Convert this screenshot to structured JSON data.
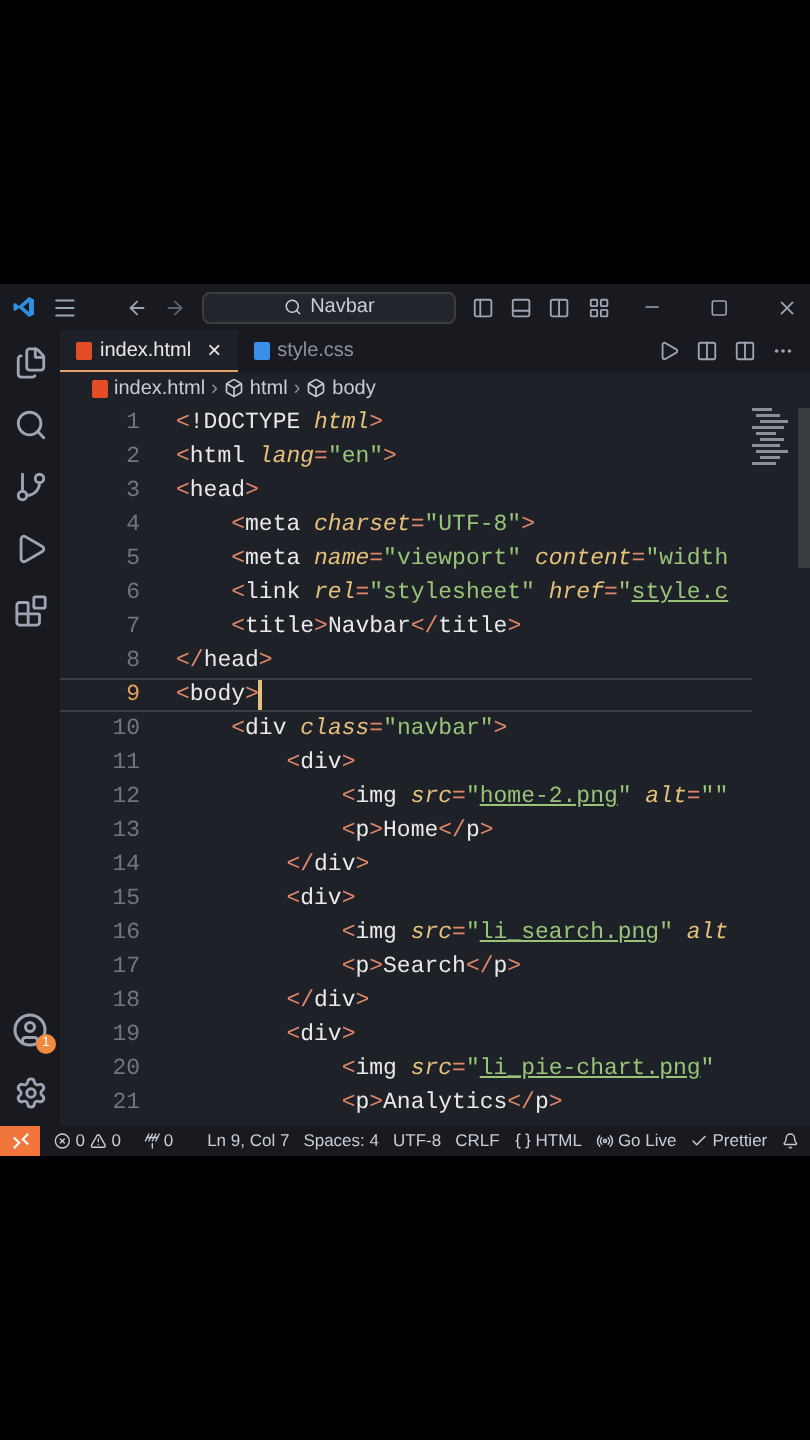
{
  "title_bar": {
    "search": "Navbar"
  },
  "tabs": [
    {
      "label": "index.html",
      "kind": "html",
      "selected": true,
      "close": "×"
    },
    {
      "label": "style.css",
      "kind": "css",
      "selected": false
    }
  ],
  "breadcrumbs": [
    {
      "label": "index.html",
      "kind": "file"
    },
    {
      "separator": "›",
      "label": "html",
      "kind": "element"
    },
    {
      "separator": "›",
      "label": "body",
      "kind": "element"
    }
  ],
  "lines": [
    {
      "number": "1",
      "current": false,
      "tokens": [
        {
          "t": "<",
          "kind": "punct"
        },
        {
          "t": "!DOCTYPE",
          "kind": "tag"
        },
        {
          "t": " html",
          "kind": "attr"
        },
        {
          "t": ">",
          "kind": "punct"
        }
      ]
    },
    {
      "number": "2",
      "current": false,
      "tokens": [
        {
          "t": "<",
          "kind": "punct"
        },
        {
          "t": "html",
          "kind": "tag"
        },
        {
          "t": " lang",
          "kind": "attr"
        },
        {
          "t": "=",
          "kind": "punct"
        },
        {
          "t": "\"en\"",
          "kind": "string"
        },
        {
          "t": ">",
          "kind": "punct"
        }
      ]
    },
    {
      "number": "3",
      "current": false,
      "tokens": [
        {
          "t": "<",
          "kind": "punct"
        },
        {
          "t": "head",
          "kind": "tag"
        },
        {
          "t": ">",
          "kind": "punct"
        }
      ]
    },
    {
      "number": "4",
      "current": false,
      "tokens": [
        {
          "t": "    <",
          "kind": "punct"
        },
        {
          "t": "meta",
          "kind": "tag"
        },
        {
          "t": " charset",
          "kind": "attr"
        },
        {
          "t": "=",
          "kind": "punct"
        },
        {
          "t": "\"UTF-8\"",
          "kind": "string"
        },
        {
          "t": ">",
          "kind": "punct"
        }
      ]
    },
    {
      "number": "5",
      "current": false,
      "tokens": [
        {
          "t": "    <",
          "kind": "punct"
        },
        {
          "t": "meta",
          "kind": "tag"
        },
        {
          "t": " name",
          "kind": "attr"
        },
        {
          "t": "=",
          "kind": "punct"
        },
        {
          "t": "\"viewport\"",
          "kind": "string"
        },
        {
          "t": " content",
          "kind": "attr"
        },
        {
          "t": "=",
          "kind": "punct"
        },
        {
          "t": "\"width",
          "kind": "string"
        }
      ]
    },
    {
      "number": "6",
      "current": false,
      "tokens": [
        {
          "t": "    <",
          "kind": "punct"
        },
        {
          "t": "link",
          "kind": "tag"
        },
        {
          "t": " rel",
          "kind": "attr"
        },
        {
          "t": "=",
          "kind": "punct"
        },
        {
          "t": "\"stylesheet\"",
          "kind": "string"
        },
        {
          "t": " href",
          "kind": "attr"
        },
        {
          "t": "=",
          "kind": "punct"
        },
        {
          "t": "\"",
          "kind": "string"
        },
        {
          "t": "style.c",
          "kind": "link"
        }
      ]
    },
    {
      "number": "7",
      "current": false,
      "tokens": [
        {
          "t": "    <",
          "kind": "punct"
        },
        {
          "t": "title",
          "kind": "tag"
        },
        {
          "t": ">",
          "kind": "punct"
        },
        {
          "t": "Navbar",
          "kind": "tag"
        },
        {
          "t": "</",
          "kind": "punct"
        },
        {
          "t": "title",
          "kind": "tag"
        },
        {
          "t": ">",
          "kind": "punct"
        }
      ]
    },
    {
      "number": "8",
      "current": false,
      "tokens": [
        {
          "t": "</",
          "kind": "punct"
        },
        {
          "t": "head",
          "kind": "tag"
        },
        {
          "t": ">",
          "kind": "punct"
        }
      ]
    },
    {
      "number": "9",
      "current": true,
      "tokens": [
        {
          "t": "<",
          "kind": "punct"
        },
        {
          "t": "body",
          "kind": "tag"
        },
        {
          "t": ">",
          "kind": "punct"
        }
      ]
    },
    {
      "number": "10",
      "current": false,
      "tokens": [
        {
          "t": "    <",
          "kind": "punct"
        },
        {
          "t": "div",
          "kind": "tag"
        },
        {
          "t": " class",
          "kind": "attr"
        },
        {
          "t": "=",
          "kind": "punct"
        },
        {
          "t": "\"navbar\"",
          "kind": "string"
        },
        {
          "t": ">",
          "kind": "punct"
        }
      ]
    },
    {
      "number": "11",
      "current": false,
      "tokens": [
        {
          "t": "        <",
          "kind": "punct"
        },
        {
          "t": "div",
          "kind": "tag"
        },
        {
          "t": ">",
          "kind": "punct"
        }
      ]
    },
    {
      "number": "12",
      "current": false,
      "tokens": [
        {
          "t": "            <",
          "kind": "punct"
        },
        {
          "t": "img",
          "kind": "tag"
        },
        {
          "t": " src",
          "kind": "attr"
        },
        {
          "t": "=",
          "kind": "punct"
        },
        {
          "t": "\"",
          "kind": "string"
        },
        {
          "t": "home-2.png",
          "kind": "link"
        },
        {
          "t": "\"",
          "kind": "string"
        },
        {
          "t": " alt",
          "kind": "attr"
        },
        {
          "t": "=",
          "kind": "punct"
        },
        {
          "t": "\"\"",
          "kind": "string"
        }
      ]
    },
    {
      "number": "13",
      "current": false,
      "tokens": [
        {
          "t": "            <",
          "kind": "punct"
        },
        {
          "t": "p",
          "kind": "tag"
        },
        {
          "t": ">",
          "kind": "punct"
        },
        {
          "t": "Home",
          "kind": "tag"
        },
        {
          "t": "</",
          "kind": "punct"
        },
        {
          "t": "p",
          "kind": "tag"
        },
        {
          "t": ">",
          "kind": "punct"
        }
      ]
    },
    {
      "number": "14",
      "current": false,
      "tokens": [
        {
          "t": "        </",
          "kind": "punct"
        },
        {
          "t": "div",
          "kind": "tag"
        },
        {
          "t": ">",
          "kind": "punct"
        }
      ]
    },
    {
      "number": "15",
      "current": false,
      "tokens": [
        {
          "t": "        <",
          "kind": "punct"
        },
        {
          "t": "div",
          "kind": "tag"
        },
        {
          "t": ">",
          "kind": "punct"
        }
      ]
    },
    {
      "number": "16",
      "current": false,
      "tokens": [
        {
          "t": "            <",
          "kind": "punct"
        },
        {
          "t": "img",
          "kind": "tag"
        },
        {
          "t": " src",
          "kind": "attr"
        },
        {
          "t": "=",
          "kind": "punct"
        },
        {
          "t": "\"",
          "kind": "string"
        },
        {
          "t": "li_search.png",
          "kind": "link"
        },
        {
          "t": "\"",
          "kind": "string"
        },
        {
          "t": " alt",
          "kind": "attr"
        }
      ]
    },
    {
      "number": "17",
      "current": false,
      "tokens": [
        {
          "t": "            <",
          "kind": "punct"
        },
        {
          "t": "p",
          "kind": "tag"
        },
        {
          "t": ">",
          "kind": "punct"
        },
        {
          "t": "Search",
          "kind": "tag"
        },
        {
          "t": "</",
          "kind": "punct"
        },
        {
          "t": "p",
          "kind": "tag"
        },
        {
          "t": ">",
          "kind": "punct"
        }
      ]
    },
    {
      "number": "18",
      "current": false,
      "tokens": [
        {
          "t": "        </",
          "kind": "punct"
        },
        {
          "t": "div",
          "kind": "tag"
        },
        {
          "t": ">",
          "kind": "punct"
        }
      ]
    },
    {
      "number": "19",
      "current": false,
      "tokens": [
        {
          "t": "        <",
          "kind": "punct"
        },
        {
          "t": "div",
          "kind": "tag"
        },
        {
          "t": ">",
          "kind": "punct"
        }
      ]
    },
    {
      "number": "20",
      "current": false,
      "tokens": [
        {
          "t": "            <",
          "kind": "punct"
        },
        {
          "t": "img",
          "kind": "tag"
        },
        {
          "t": " src",
          "kind": "attr"
        },
        {
          "t": "=",
          "kind": "punct"
        },
        {
          "t": "\"",
          "kind": "string"
        },
        {
          "t": "li_pie-chart.png",
          "kind": "link"
        },
        {
          "t": "\"",
          "kind": "string"
        }
      ]
    },
    {
      "number": "21",
      "current": false,
      "tokens": [
        {
          "t": "            <",
          "kind": "punct"
        },
        {
          "t": "p",
          "kind": "tag"
        },
        {
          "t": ">",
          "kind": "punct"
        },
        {
          "t": "Analytics",
          "kind": "tag"
        },
        {
          "t": "</",
          "kind": "punct"
        },
        {
          "t": "p",
          "kind": "tag"
        },
        {
          "t": ">",
          "kind": "punct"
        }
      ]
    }
  ],
  "accounts_badge": "1",
  "status_bar": {
    "errors": "0",
    "warnings": "0",
    "ports": "0",
    "items": [
      {
        "label": "Ln 9, Col 7",
        "kind": "text"
      },
      {
        "label": "Spaces: 4",
        "kind": "text"
      },
      {
        "label": "UTF-8",
        "kind": "text"
      },
      {
        "label": "CRLF",
        "kind": "text"
      },
      {
        "label": "HTML",
        "kind": "lang"
      },
      {
        "label": "Go Live",
        "kind": "live"
      },
      {
        "label": "Prettier",
        "kind": "check"
      }
    ]
  }
}
